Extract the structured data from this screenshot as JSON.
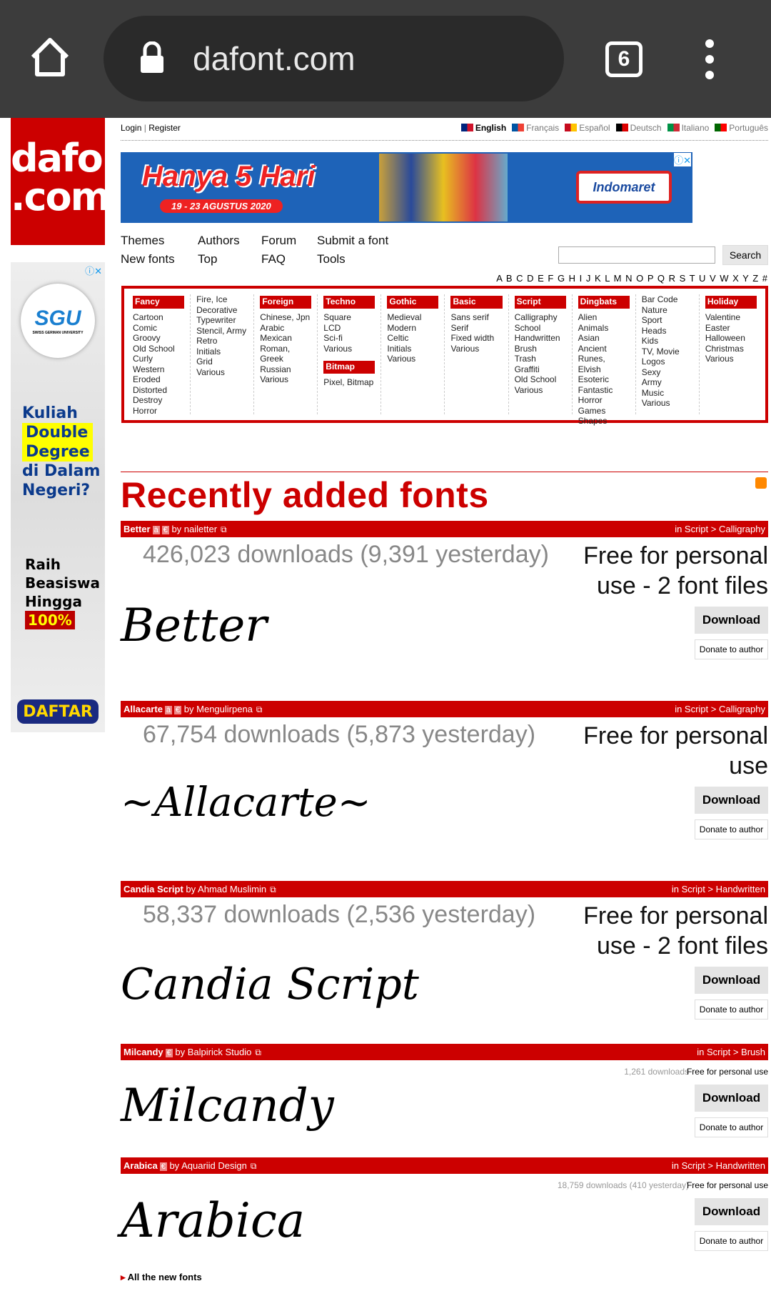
{
  "browser": {
    "url": "dafont.com",
    "tab_count": "6"
  },
  "logo": {
    "line1": "dafont",
    "line2": ".com"
  },
  "side_ad": {
    "brand": "SGU",
    "brand_sub": "SWISS GERMAN UNIVERSITY",
    "l1": "Kuliah",
    "l2": "Double",
    "l3": "Degree",
    "l4": "di Dalam",
    "l5": "Negeri?",
    "m1": "Raih",
    "m2": "Beasiswa",
    "m3": "Hingga",
    "m4": "100%",
    "cta": "DAFTAR"
  },
  "top": {
    "login": "Login",
    "register": "Register",
    "languages": [
      {
        "label": "English",
        "colors": [
          "#00247d",
          "#cf142b"
        ]
      },
      {
        "label": "Français",
        "colors": [
          "#0055a4",
          "#ef4135"
        ]
      },
      {
        "label": "Español",
        "colors": [
          "#c60b1e",
          "#ffc400"
        ]
      },
      {
        "label": "Deutsch",
        "colors": [
          "#000",
          "#dd0000"
        ]
      },
      {
        "label": "Italiano",
        "colors": [
          "#009246",
          "#ce2b37"
        ]
      },
      {
        "label": "Português",
        "colors": [
          "#006600",
          "#ff0000"
        ]
      }
    ]
  },
  "banner": {
    "headline": "Hanya 5 Hari",
    "dates": "19 - 23 AGUSTUS 2020",
    "brand": "Indomaret"
  },
  "nav": {
    "row1": [
      "Themes",
      "Authors",
      "Forum",
      "Submit a font"
    ],
    "row2": [
      "New fonts",
      "Top",
      "FAQ",
      "Tools"
    ],
    "search_label": "Search",
    "search_value": ""
  },
  "alphabet": "A B C D E F G H I J K L M N O P Q R S T U V W X Y Z #",
  "categories": [
    [
      {
        "h": "Fancy",
        "items": [
          "Cartoon",
          "Comic",
          "Groovy",
          "Old School",
          "Curly",
          "Western",
          "Eroded",
          "Distorted",
          "Destroy",
          "Horror"
        ]
      }
    ],
    [
      {
        "h": "",
        "items": [
          "Fire, Ice",
          "Decorative",
          "Typewriter",
          "Stencil, Army",
          "Retro",
          "Initials",
          "Grid",
          "Various"
        ]
      }
    ],
    [
      {
        "h": "Foreign look",
        "items": [
          "Chinese, Jpn",
          "Arabic",
          "Mexican",
          "Roman, Greek",
          "Russian",
          "Various"
        ]
      }
    ],
    [
      {
        "h": "Techno",
        "items": [
          "Square",
          "LCD",
          "Sci-fi",
          "Various"
        ]
      },
      {
        "h": "Bitmap",
        "items": [
          "Pixel, Bitmap"
        ]
      }
    ],
    [
      {
        "h": "Gothic",
        "items": [
          "Medieval",
          "Modern",
          "Celtic",
          "Initials",
          "Various"
        ]
      }
    ],
    [
      {
        "h": "Basic",
        "items": [
          "Sans serif",
          "Serif",
          "Fixed width",
          "Various"
        ]
      }
    ],
    [
      {
        "h": "Script",
        "items": [
          "Calligraphy",
          "School",
          "Handwritten",
          "Brush",
          "Trash",
          "Graffiti",
          "Old School",
          "Various"
        ]
      }
    ],
    [
      {
        "h": "Dingbats",
        "items": [
          "Alien",
          "Animals",
          "Asian",
          "Ancient",
          "Runes, Elvish",
          "Esoteric",
          "Fantastic",
          "Horror",
          "Games",
          "Shapes"
        ]
      }
    ],
    [
      {
        "h": "",
        "items": [
          "Bar Code",
          "Nature",
          "Sport",
          "Heads",
          "Kids",
          "TV, Movie",
          "Logos",
          "Sexy",
          "Army",
          "Music",
          "Various"
        ]
      }
    ],
    [
      {
        "h": "Holiday",
        "items": [
          "Valentine",
          "Easter",
          "Halloween",
          "Christmas",
          "Various"
        ]
      }
    ]
  ],
  "section_title": "Recently added fonts",
  "fonts": [
    {
      "name": "Better",
      "tags": [
        "à",
        "€"
      ],
      "author": "by nailetter",
      "category": "in Script > Calligraphy",
      "downloads": "426,023 downloads (9,391 yesterday)",
      "license": "Free for personal use - 2 font files",
      "preview": "Better",
      "big": true
    },
    {
      "name": "Allacarte",
      "tags": [
        "à",
        "€"
      ],
      "author": "by Mengulirpena",
      "category": "in Script > Calligraphy",
      "downloads": "67,754 downloads (5,873 yesterday)",
      "license": "Free for personal use",
      "preview": "~Allacarte~",
      "big": true
    },
    {
      "name": "Candia Script",
      "tags": [],
      "author": "by Ahmad Muslimin",
      "category": "in Script > Handwritten",
      "downloads": "58,337 downloads (2,536 yesterday)",
      "license": "Free for personal use - 2 font files",
      "preview": "Candia Script",
      "big": true
    },
    {
      "name": "Milcandy",
      "tags": [
        "€"
      ],
      "author": "by Balpirick Studio",
      "category": "in Script > Brush",
      "downloads": "1,261 downloads",
      "license": "Free for personal use",
      "preview": "Milcandy",
      "big": false
    },
    {
      "name": "Arabica",
      "tags": [
        "€"
      ],
      "author": "by Aquariid Design",
      "category": "in Script > Handwritten",
      "downloads": "18,759 downloads (410 yesterday)",
      "license": "Free for personal use",
      "preview": "Arabica",
      "big": false
    }
  ],
  "download_label": "Download",
  "donate_label": "Donate to author",
  "all_fonts_link": "All the new fonts",
  "colors": {
    "brand_red": "#cc0000",
    "chrome_bar": "#3c3c3c"
  }
}
